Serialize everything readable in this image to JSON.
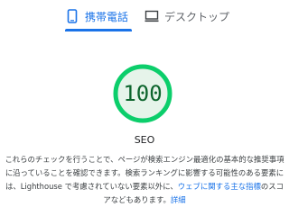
{
  "tabs": [
    {
      "label": "携帯電話",
      "icon": "mobile-phone-icon",
      "selected": true
    },
    {
      "label": "デスクトップ",
      "icon": "desktop-icon",
      "selected": false
    }
  ],
  "score": {
    "value": "100",
    "fraction": 1.0,
    "color": "#0cce6b",
    "text_color": "#0d652d",
    "background": "#e6f4ea"
  },
  "category": {
    "title": "SEO",
    "description": {
      "text": "これらのチェックを行うことで、ページが検索エンジン最適化の基本的な推奨事項に沿っていることを確認できます。検索ランキングに影響する可能性のある要素には、Lighthouse で考慮されていない要素以外に、",
      "link1": "ウェブに関する主な指標",
      "middle": "のスコアなどもあります。",
      "link2": "詳細"
    }
  },
  "colors": {
    "accent": "#1a73e8",
    "muted": "#5f6368"
  }
}
